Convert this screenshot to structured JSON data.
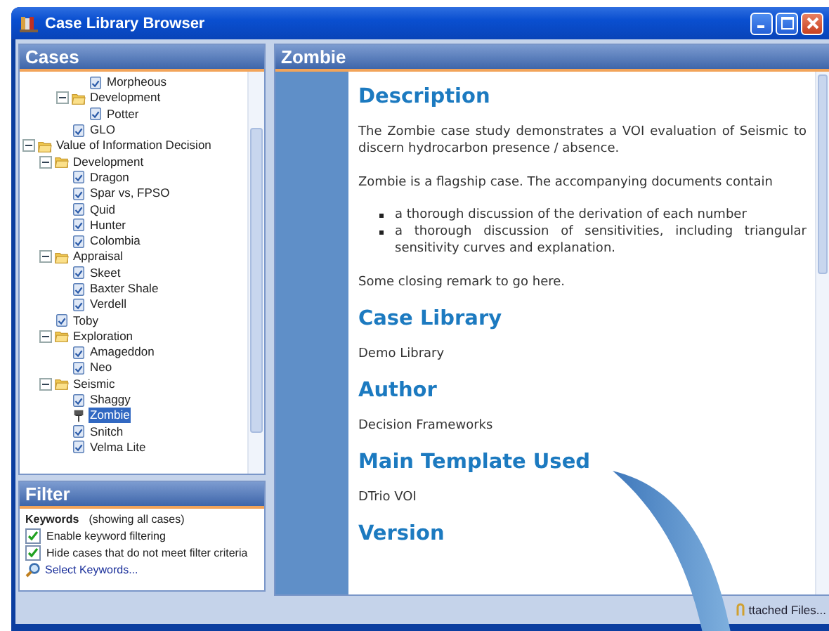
{
  "window": {
    "title": "Case Library Browser"
  },
  "cases_panel": {
    "title": "Cases"
  },
  "tree": {
    "cut_off_branch": {
      "children": [
        {
          "children": [
            {
              "label": "Morpheous",
              "kind": "case",
              "selected": false
            }
          ]
        },
        {
          "label": "Development",
          "kind": "folder",
          "expanded": true,
          "children": [
            {
              "label": "Potter",
              "kind": "case",
              "selected": false
            }
          ]
        },
        {
          "label": "GLO",
          "kind": "case",
          "selected": false
        }
      ]
    },
    "items": [
      {
        "label": "Value of Information Decision",
        "kind": "folder",
        "expanded": true,
        "children": [
          {
            "label": "Development",
            "kind": "folder",
            "expanded": true,
            "children": [
              {
                "label": "Dragon",
                "kind": "case",
                "selected": false
              },
              {
                "label": "Spar vs, FPSO",
                "kind": "case",
                "selected": false
              },
              {
                "label": "Quid",
                "kind": "case",
                "selected": false
              },
              {
                "label": "Hunter",
                "kind": "case",
                "selected": false
              },
              {
                "label": "Colombia",
                "kind": "case",
                "selected": false
              }
            ]
          },
          {
            "label": "Appraisal",
            "kind": "folder",
            "expanded": true,
            "children": [
              {
                "label": "Skeet",
                "kind": "case",
                "selected": false
              },
              {
                "label": "Baxter Shale",
                "kind": "case",
                "selected": false
              },
              {
                "label": "Verdell",
                "kind": "case",
                "selected": false
              }
            ]
          },
          {
            "label": "Toby",
            "kind": "case",
            "selected": false
          },
          {
            "label": "Exploration",
            "kind": "folder",
            "expanded": true,
            "children": [
              {
                "label": "Amageddon",
                "kind": "case",
                "selected": false
              },
              {
                "label": "Neo",
                "kind": "case",
                "selected": false
              }
            ]
          },
          {
            "label": "Seismic",
            "kind": "folder",
            "expanded": true,
            "children": [
              {
                "label": "Shaggy",
                "kind": "case",
                "selected": false
              },
              {
                "label": "Zombie",
                "kind": "case",
                "selected": true
              },
              {
                "label": "Snitch",
                "kind": "case",
                "selected": false
              },
              {
                "label": "Velma Lite",
                "kind": "case",
                "selected": false
              }
            ]
          }
        ]
      }
    ]
  },
  "filter": {
    "title": "Filter",
    "keywords_label": "Keywords",
    "keywords_status": "(showing all cases)",
    "options": [
      {
        "label": "Enable keyword filtering",
        "checked": true
      },
      {
        "label": "Hide cases that do not meet filter criteria",
        "checked": true
      }
    ],
    "link": "Select Keywords..."
  },
  "detail": {
    "title": "Zombie",
    "sections": [
      {
        "heading": "Description",
        "blocks": [
          {
            "kind": "paragraph",
            "text": "The Zombie case study demonstrates a VOI evaluation of Seismic to discern hydrocarbon presence / absence."
          },
          {
            "kind": "paragraph",
            "text": "Zombie is a flagship case. The accompanying documents contain"
          },
          {
            "kind": "bullets",
            "items": [
              "a thorough discussion of the derivation of each number",
              "a thorough discussion of sensitivities, including triangular sensitivity curves and explanation."
            ]
          },
          {
            "kind": "paragraph",
            "text": "Some closing remark to go here."
          }
        ]
      },
      {
        "heading": "Case Library",
        "blocks": [
          {
            "kind": "paragraph",
            "text": "Demo Library"
          }
        ]
      },
      {
        "heading": "Author",
        "blocks": [
          {
            "kind": "paragraph",
            "text": "Decision Frameworks"
          }
        ]
      },
      {
        "heading": "Main Template Used",
        "blocks": [
          {
            "kind": "paragraph",
            "text": "DTrio VOI"
          }
        ]
      },
      {
        "heading": "Version"
      }
    ]
  },
  "status_bar": {
    "attached_files": "ttached Files..."
  }
}
